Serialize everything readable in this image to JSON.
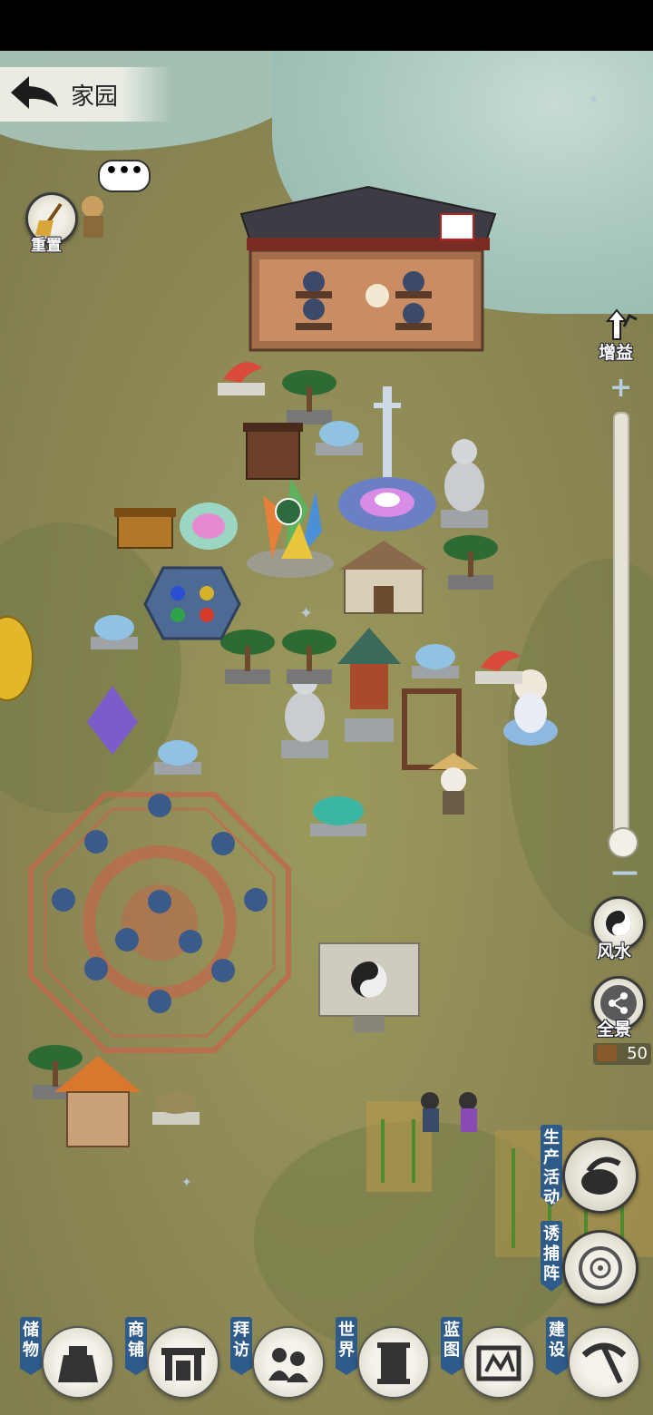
{
  "header": {
    "title": "家园"
  },
  "left_tools": {
    "reset_label": "重置",
    "bubble_text": "•••"
  },
  "right_panel": {
    "boost_label": "增益",
    "fengshui_label": "风水",
    "panorama_label": "全景",
    "resource_value": "50"
  },
  "activities": {
    "production_label": "生产活动",
    "lure_label": "诱捕阵"
  },
  "dock": {
    "items": [
      {
        "label": "储物",
        "icon": "bag-icon"
      },
      {
        "label": "商铺",
        "icon": "shop-gate-icon"
      },
      {
        "label": "拜访",
        "icon": "visit-icon"
      },
      {
        "label": "世界",
        "icon": "scroll-icon"
      },
      {
        "label": "蓝图",
        "icon": "blueprint-icon"
      },
      {
        "label": "建设",
        "icon": "pickaxe-icon"
      }
    ]
  },
  "colors": {
    "ground": "#8f8a56",
    "water": "#a9c8bf",
    "label_blue": "#2f5b8a",
    "circle_red": "#c0684a"
  }
}
